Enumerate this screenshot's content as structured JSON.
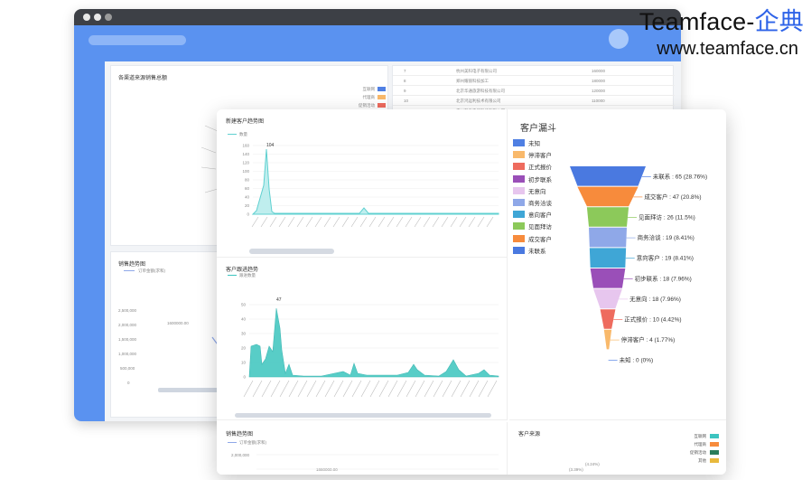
{
  "brand": {
    "name_prefix": "Teamface-",
    "name_suffix": "企典",
    "url": "www.teamface.cn",
    "accent_color": "#2e63e8"
  },
  "funnel": {
    "title": "客户漏斗",
    "legend": [
      {
        "label": "未知",
        "color": "#4f7fe3"
      },
      {
        "label": "停滞客户",
        "color": "#f9b96b"
      },
      {
        "label": "正式报价",
        "color": "#ee6b5e"
      },
      {
        "label": "初步联系",
        "color": "#9a4fb8"
      },
      {
        "label": "无意向",
        "color": "#e7c6ee"
      },
      {
        "label": "商务洽谈",
        "color": "#8fa8e8"
      },
      {
        "label": "意向客户",
        "color": "#3fa6d6"
      },
      {
        "label": "见面拜访",
        "color": "#8cc95a"
      },
      {
        "label": "成交客户",
        "color": "#f78b3c"
      },
      {
        "label": "未联系",
        "color": "#4a79e0"
      }
    ],
    "stages": [
      {
        "label": "未联系 : 65 (28.76%)",
        "value": 65,
        "color": "#4a79e0"
      },
      {
        "label": "成交客户 : 47 (20.8%)",
        "value": 47,
        "color": "#f78b3c"
      },
      {
        "label": "见面拜访 : 26 (11.5%)",
        "value": 26,
        "color": "#8cc95a"
      },
      {
        "label": "商务洽谈 : 19 (8.41%)",
        "value": 19,
        "color": "#8fa8e8"
      },
      {
        "label": "意向客户 : 19 (8.41%)",
        "value": 19,
        "color": "#3fa6d6"
      },
      {
        "label": "初步联系 : 18 (7.96%)",
        "value": 18,
        "color": "#9a4fb8"
      },
      {
        "label": "无意向 : 18 (7.96%)",
        "value": 18,
        "color": "#e7c6ee"
      },
      {
        "label": "正式报价 : 10 (4.42%)",
        "value": 10,
        "color": "#ee6b5e"
      },
      {
        "label": "停滞客户 : 4 (1.77%)",
        "value": 4,
        "color": "#f9b96b"
      },
      {
        "label": "未知 : 0 (0%)",
        "value": 0,
        "color": "#4f7fe3"
      }
    ]
  },
  "new_customer_chart": {
    "title": "新建客户趋势图",
    "legend": "数量",
    "peak_label": "104",
    "y_ticks": [
      "0",
      "20",
      "40",
      "60",
      "80",
      "100",
      "120",
      "140",
      "160"
    ],
    "series_color": "#5fd0d0"
  },
  "follow_chart": {
    "title": "客户跟进趋势",
    "legend": "跟进数量",
    "peak_label": "47",
    "y_ticks": [
      "0",
      "10",
      "20",
      "30",
      "40",
      "50"
    ],
    "series_color": "#3cc4c0"
  },
  "sales_chart_front": {
    "title": "销售趋势图",
    "legend": "订单金额(求和)",
    "y_tick": "2,000,000",
    "point_label": "1860000.00"
  },
  "customer_source": {
    "title": "客户来源",
    "pct_label": "(4.24%)",
    "pct_label2": "(3.39%)",
    "legend": [
      {
        "label": "互联网",
        "color": "#3cc4c0"
      },
      {
        "label": "代理商",
        "color": "#f78b3c"
      },
      {
        "label": "促销活动",
        "color": "#2a7d5a"
      },
      {
        "label": "其他",
        "color": "#e8b93c"
      }
    ]
  },
  "back": {
    "source_panel_title": "各渠道来源销售总额",
    "source_legend": [
      {
        "label": "互联网",
        "color": "#4f7fe3"
      },
      {
        "label": "代理商",
        "color": "#f9b96b"
      },
      {
        "label": "促销活动",
        "color": "#ee6b5e"
      }
    ],
    "sales_panel_title": "销售趋势图",
    "sales_legend": "订单金额(求和)",
    "sales_y_ticks": [
      "0",
      "500,000",
      "1,000,000",
      "1,500,000",
      "2,000,000",
      "2,500,000"
    ],
    "sales_point_label": "1600000.00",
    "table_rows": [
      {
        "no": "7",
        "company": "杭州美科电子有限公司",
        "amount": "160000"
      },
      {
        "no": "8",
        "company": "郑州耀丽科技加工",
        "amount": "180000"
      },
      {
        "no": "9",
        "company": "北京华通旅游科技有限公司",
        "amount": "120000"
      },
      {
        "no": "10",
        "company": "北京鸿运利技术有限公司",
        "amount": "110000"
      },
      {
        "no": "11",
        "company": "广州和泰电器科技有限公司",
        "amount": "100000"
      }
    ]
  }
}
